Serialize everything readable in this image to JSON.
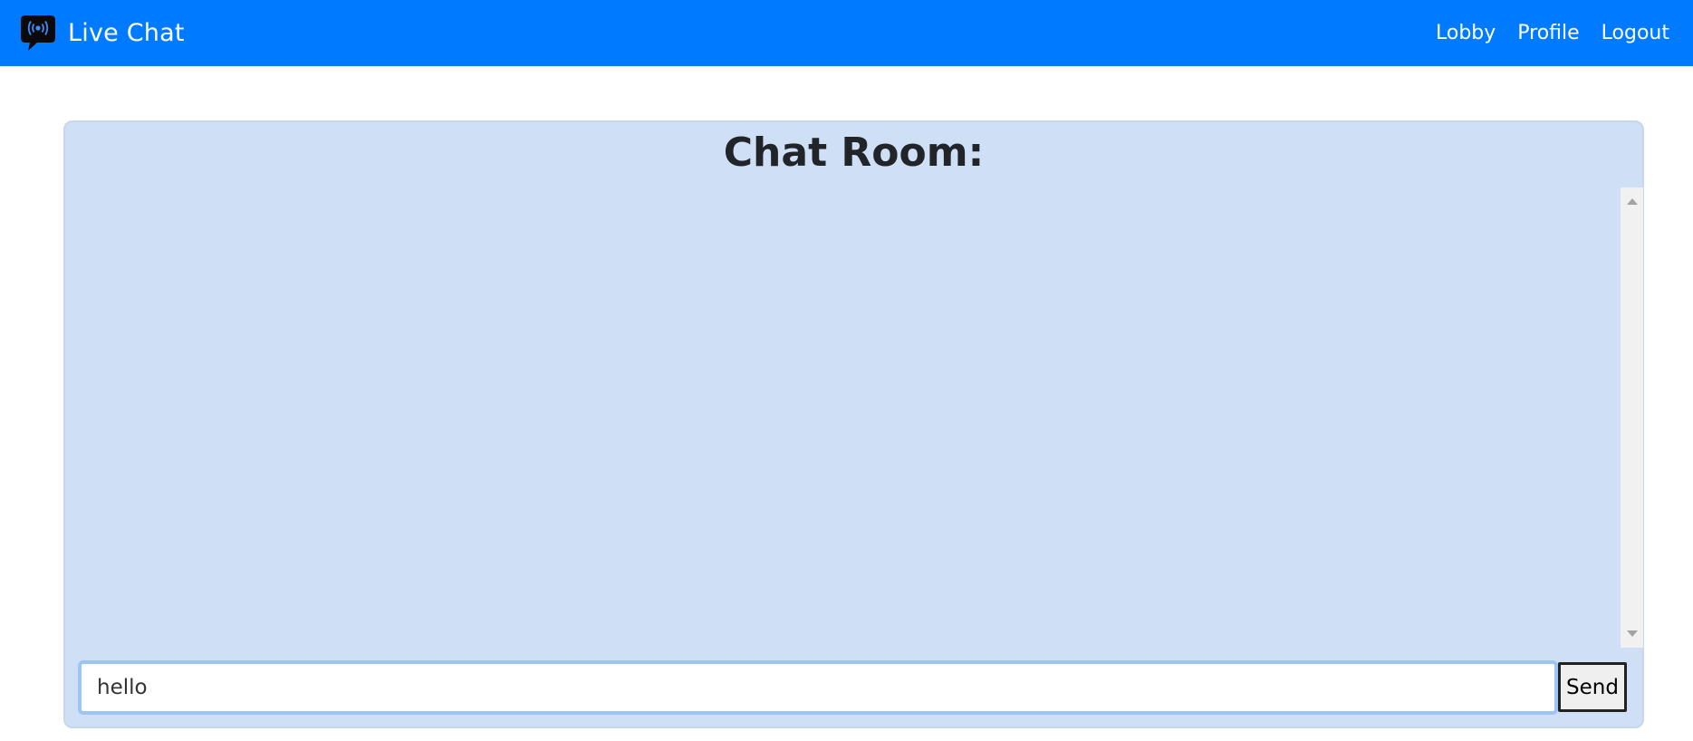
{
  "app": {
    "brand_name": "Live Chat",
    "logo_icon": "broadcast-chat-bubble-icon"
  },
  "nav": {
    "items": [
      {
        "label": "Lobby"
      },
      {
        "label": "Profile"
      },
      {
        "label": "Logout"
      }
    ]
  },
  "chat": {
    "title": "Chat Room:",
    "messages": [],
    "input_value": "hello",
    "send_label": "Send"
  },
  "colors": {
    "navbar": "#007bff",
    "card_background": "#cfdff5",
    "input_focus_border": "#9cc4f5",
    "text_dark": "#212529"
  }
}
